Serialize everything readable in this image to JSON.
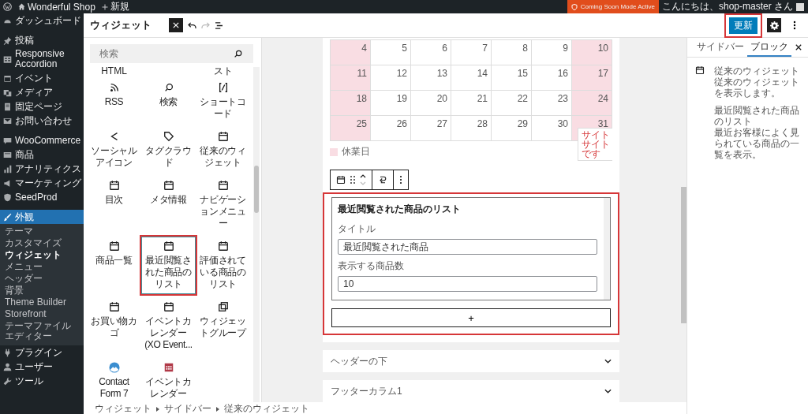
{
  "admin_bar": {
    "site_name": "Wonderful Shop",
    "new_label": "新規",
    "coming_soon": "Coming Soon Mode Active",
    "greeting": "こんにちは、shop-master さん"
  },
  "admin_menu": [
    {
      "label": "ダッシュボード",
      "kind": "gauge",
      "selected": false
    },
    {
      "label": "投稿",
      "kind": "pin",
      "selected": false
    },
    {
      "label": "Responsive Accordion",
      "kind": "table",
      "selected": false
    },
    {
      "label": "イベント",
      "kind": "calendar",
      "selected": false
    },
    {
      "label": "メディア",
      "kind": "media",
      "selected": false
    },
    {
      "label": "固定ページ",
      "kind": "page",
      "selected": false
    },
    {
      "label": "お問い合わせ",
      "kind": "mail",
      "selected": false
    },
    {
      "label": "WooCommerce",
      "kind": "woo",
      "selected": false
    },
    {
      "label": "商品",
      "kind": "box",
      "selected": false
    },
    {
      "label": "アナリティクス",
      "kind": "chart",
      "selected": false
    },
    {
      "label": "マーケティング",
      "kind": "megaphone",
      "selected": false
    },
    {
      "label": "SeedProd",
      "kind": "seedprod",
      "selected": false
    },
    {
      "label": "外観",
      "kind": "brush",
      "selected": true,
      "children": [
        {
          "label": "テーマ",
          "selected": false
        },
        {
          "label": "カスタマイズ",
          "selected": false
        },
        {
          "label": "ウィジェット",
          "selected": true
        },
        {
          "label": "メニュー",
          "selected": false
        },
        {
          "label": "ヘッダー",
          "selected": false
        },
        {
          "label": "背景",
          "selected": false
        },
        {
          "label": "Theme Builder",
          "selected": false
        },
        {
          "label": "Storefront",
          "selected": false
        },
        {
          "label": "テーマファイルエディター",
          "selected": false
        }
      ]
    },
    {
      "label": "プラグイン",
      "kind": "plugin",
      "selected": false
    },
    {
      "label": "ユーザー",
      "kind": "user",
      "selected": false
    },
    {
      "label": "ツール",
      "kind": "wrench",
      "selected": false
    }
  ],
  "header": {
    "title": "ウィジェット",
    "update_button": {
      "label": "更新",
      "highlighted": true
    }
  },
  "inserter": {
    "search": {
      "placeholder": "検索"
    },
    "partial_row": [
      {
        "label": "HTML",
        "kind": "text"
      },
      {
        "kind": "hidden"
      },
      {
        "label": "スト",
        "kind": "text"
      }
    ],
    "items": [
      {
        "label": "RSS",
        "kind": "rss",
        "selected": false,
        "highlighted": false
      },
      {
        "label": "検索",
        "kind": "search",
        "selected": false,
        "highlighted": false
      },
      {
        "label": "ショートコード",
        "kind": "shortcode",
        "selected": false,
        "highlighted": false
      },
      {
        "label": "ソーシャルアイコン",
        "kind": "share",
        "selected": false,
        "highlighted": false
      },
      {
        "label": "タグクラウド",
        "kind": "tag",
        "selected": false,
        "highlighted": false
      },
      {
        "label": "従来のウィジェット",
        "kind": "calendar",
        "selected": false,
        "highlighted": false
      },
      {
        "label": "目次",
        "kind": "calendar",
        "selected": false,
        "highlighted": false
      },
      {
        "label": "メタ情報",
        "kind": "calendar",
        "selected": false,
        "highlighted": false
      },
      {
        "label": "ナビゲーションメニュー",
        "kind": "calendar",
        "selected": false,
        "highlighted": false
      },
      {
        "label": "商品一覧",
        "kind": "calendar",
        "selected": false,
        "highlighted": false
      },
      {
        "label": "最近閲覧された商品のリスト",
        "kind": "calendar",
        "selected": true,
        "highlighted": true
      },
      {
        "label": "評価されている商品のリスト",
        "kind": "calendar",
        "selected": false,
        "highlighted": false
      },
      {
        "label": "お買い物カゴ",
        "kind": "calendar",
        "selected": false,
        "highlighted": false
      },
      {
        "label": "イベントカレンダー (XO Event...",
        "kind": "calendar",
        "selected": false,
        "highlighted": false
      },
      {
        "label": "ウィジェットグループ",
        "kind": "group",
        "selected": false,
        "highlighted": false
      },
      {
        "label": "Contact Form 7",
        "kind": "contact",
        "selected": false,
        "highlighted": false
      },
      {
        "label": "イベントカレンダー",
        "kind": "event",
        "selected": false,
        "highlighted": false
      }
    ]
  },
  "canvas": {
    "calendar": {
      "rows": [
        [
          {
            "day": "4",
            "holiday": true
          },
          {
            "day": "5",
            "holiday": false
          },
          {
            "day": "6",
            "holiday": false
          },
          {
            "day": "7",
            "holiday": false
          },
          {
            "day": "8",
            "holiday": false
          },
          {
            "day": "9",
            "holiday": false
          },
          {
            "day": "10",
            "holiday": true
          }
        ],
        [
          {
            "day": "11",
            "holiday": true
          },
          {
            "day": "12",
            "holiday": false
          },
          {
            "day": "13",
            "holiday": false
          },
          {
            "day": "14",
            "holiday": false
          },
          {
            "day": "15",
            "holiday": false
          },
          {
            "day": "16",
            "holiday": false
          },
          {
            "day": "17",
            "holiday": true
          }
        ],
        [
          {
            "day": "18",
            "holiday": true
          },
          {
            "day": "19",
            "holiday": false
          },
          {
            "day": "20",
            "holiday": false
          },
          {
            "day": "21",
            "holiday": false
          },
          {
            "day": "22",
            "holiday": false
          },
          {
            "day": "23",
            "holiday": false
          },
          {
            "day": "24",
            "holiday": true
          }
        ],
        [
          {
            "day": "25",
            "holiday": true
          },
          {
            "day": "26",
            "holiday": false
          },
          {
            "day": "27",
            "holiday": false
          },
          {
            "day": "28",
            "holiday": false
          },
          {
            "day": "29",
            "holiday": false
          },
          {
            "day": "30",
            "holiday": false
          },
          {
            "day": "31",
            "holiday": true
          }
        ]
      ],
      "legend": "休業日"
    },
    "notice": [
      "サイト",
      "サイト",
      "です"
    ],
    "block": {
      "title": "最近閲覧された商品のリスト",
      "highlighted": true,
      "fields": [
        {
          "label": "タイトル",
          "value": "最近閲覧された商品"
        },
        {
          "label": "表示する商品数",
          "value": "10"
        }
      ],
      "append_label": "+"
    },
    "areas": [
      {
        "label": "ヘッダーの下",
        "expanded": false
      },
      {
        "label": "フッターカラム1",
        "expanded": false
      }
    ]
  },
  "settings": {
    "tabs": [
      {
        "label": "サイドバー",
        "selected": false
      },
      {
        "label": "ブロック",
        "selected": true
      }
    ],
    "block_card": {
      "title": "従来のウィジェット",
      "description": "従来のウィジェットを表示します。",
      "widget_name": "最近閲覧された商品のリスト",
      "widget_description": "最近お客様によく見られている商品の一覧を表示。"
    }
  },
  "breadcrumb": [
    "ウィジェット",
    "サイドバー",
    "従来のウィジェット"
  ]
}
